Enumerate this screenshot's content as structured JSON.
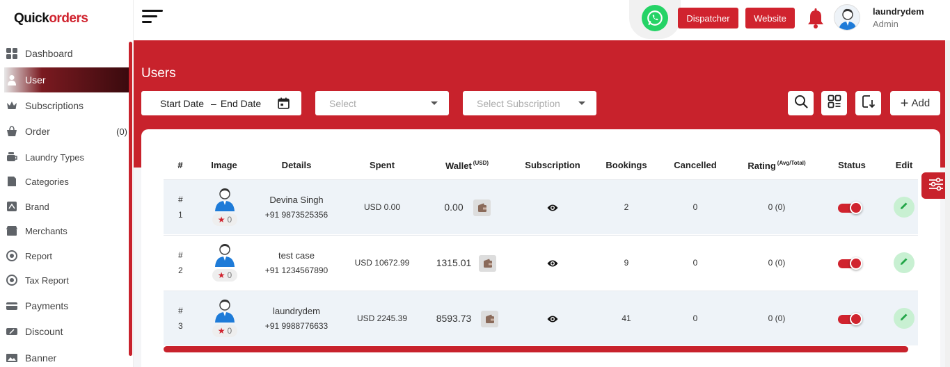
{
  "brand": {
    "logo_left": "Quick",
    "logo_right": "Orders",
    "logo_mark": "o"
  },
  "sidebar": {
    "items": [
      {
        "label": "Dashboard",
        "icon": "dashboard-icon"
      },
      {
        "label": "User",
        "icon": "user-icon",
        "active": true
      },
      {
        "label": "Subscriptions",
        "icon": "crown-icon"
      },
      {
        "label": "Order",
        "icon": "basket-icon",
        "count": "(0)"
      },
      {
        "label": "Laundry Types",
        "icon": "laundry-icon"
      },
      {
        "label": "Categories",
        "icon": "categories-icon"
      },
      {
        "label": "Brand",
        "icon": "brand-icon"
      },
      {
        "label": "Merchants",
        "icon": "merchants-icon"
      },
      {
        "label": "Report",
        "icon": "report-icon"
      },
      {
        "label": "Tax Report",
        "icon": "tax-report-icon"
      },
      {
        "label": "Payments",
        "icon": "payments-icon"
      },
      {
        "label": "Discount",
        "icon": "discount-icon"
      },
      {
        "label": "Banner",
        "icon": "banner-icon"
      }
    ]
  },
  "topbar": {
    "dispatcher_label": "Dispatcher",
    "website_label": "Website",
    "user_name": "laundrydem",
    "user_role": "Admin"
  },
  "page": {
    "title": "Users",
    "date_start": "Start Date",
    "date_sep": "–",
    "date_end": "End Date",
    "select_placeholder": "Select",
    "subscription_placeholder": "Select Subscription",
    "add_label": "Add"
  },
  "table": {
    "columns": {
      "num": "#",
      "image": "Image",
      "details": "Details",
      "spent": "Spent",
      "wallet": "Wallet",
      "wallet_sup": "(USD)",
      "subscription": "Subscription",
      "bookings": "Bookings",
      "cancelled": "Cancelled",
      "rating": "Rating",
      "rating_sup": "(Avg/Total)",
      "status": "Status",
      "edit": "Edit"
    },
    "rows": [
      {
        "hash": "#",
        "index": "1",
        "rating_count": "0",
        "name": "Devina Singh",
        "phone": "+91 9873525356",
        "spent": "USD 0.00",
        "wallet": "0.00",
        "bookings": "2",
        "cancelled": "0",
        "rating": "0 (0)",
        "status": true
      },
      {
        "hash": "#",
        "index": "2",
        "rating_count": "0",
        "name": "test case",
        "phone": "+91 1234567890",
        "spent": "USD 10672.99",
        "wallet": "1315.01",
        "bookings": "9",
        "cancelled": "0",
        "rating": "0 (0)",
        "status": true
      },
      {
        "hash": "#",
        "index": "3",
        "rating_count": "0",
        "name": "laundrydem",
        "phone": "+91 9988776633",
        "spent": "USD 2245.39",
        "wallet": "8593.73",
        "bookings": "41",
        "cancelled": "0",
        "rating": "0 (0)",
        "status": true
      }
    ]
  },
  "colors": {
    "primary": "#c8222c",
    "whatsapp": "#25d366",
    "edit_bg": "#c8f0d2"
  }
}
